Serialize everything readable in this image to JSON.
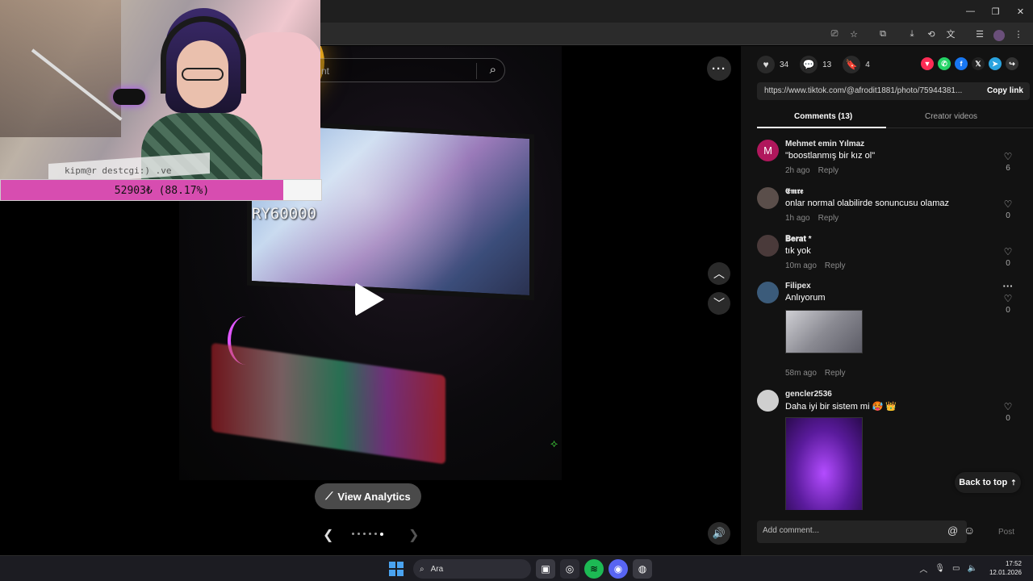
{
  "window": {
    "minimize": "—",
    "restore": "❐",
    "close": "✕"
  },
  "media": {
    "search_placeholder": "nt",
    "view_analytics": "View Analytics",
    "carousel_dots": 6,
    "carousel_active_index": 5
  },
  "overlay": {
    "webcam_watermark": "kipm@r destcgi:) .ve",
    "donation_amount": "52903₺ (88.17%)",
    "donation_progress": 0.8817,
    "goal_label": "RY60000"
  },
  "panel": {
    "actions": [
      {
        "icon": "heart-icon",
        "count": "34"
      },
      {
        "icon": "comment-icon",
        "count": "13"
      },
      {
        "icon": "bookmark-icon",
        "count": "4"
      }
    ],
    "share_colors": [
      "#fe2c55",
      "#25d366",
      "#1877f2",
      "#222222",
      "#2aa3df",
      "#333333"
    ],
    "link_url": "https://www.tiktok.com/@afrodit1881/photo/75944381...",
    "copy_link": "Copy link",
    "tabs": [
      "Comments (13)",
      "Creator videos"
    ],
    "comments": [
      {
        "user": "Mehmet emin Yılmaz",
        "text": "\"boostlanmış bir kız ol\"",
        "time": "2h ago",
        "reply": "Reply",
        "likes": "6",
        "avatar_color": "#b0175c",
        "avatar_letter": "M"
      },
      {
        "user": "𝕰𝖒𝖗𝖊",
        "text": "onlar normal olabilirde sonuncusu olamaz",
        "time": "1h ago",
        "reply": "Reply",
        "likes": "0",
        "avatar_color": "#5a4e4a",
        "avatar_letter": ""
      },
      {
        "user": "𝐁𝐞𝐫𝐚𝐭 *",
        "text": "tık yok",
        "time": "10m ago",
        "reply": "Reply",
        "likes": "0",
        "avatar_color": "#4a3a3a",
        "avatar_letter": ""
      },
      {
        "user": "Filipex",
        "text": "Anlıyorum",
        "time": "58m ago",
        "reply": "Reply",
        "likes": "0",
        "avatar_color": "#3b5b7a",
        "avatar_letter": ""
      },
      {
        "user": "gencler2536",
        "text": "Daha iyi bir sistem mi 🥵 👑",
        "time": "",
        "reply": "",
        "likes": "0",
        "avatar_color": "#cfcfcf",
        "avatar_letter": ""
      }
    ],
    "back_to_top": "Back to top",
    "comment_placeholder": "Add comment...",
    "post": "Post"
  },
  "taskbar": {
    "search": "Ara",
    "time": "17:52",
    "date": "12.01.2026"
  }
}
